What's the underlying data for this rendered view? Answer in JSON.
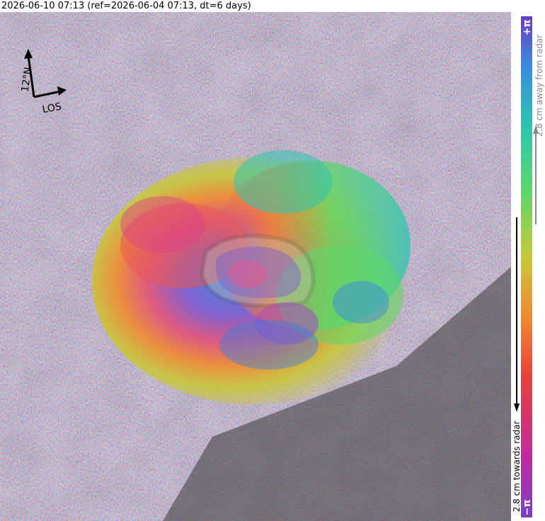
{
  "header": {
    "title": "2026-06-10 07:13 (ref=2026-06-04 07:13, dt=6 days)"
  },
  "compass": {
    "north_label": "12°N",
    "los_label": "LOS"
  },
  "colorbar": {
    "top_label": "+π",
    "bottom_label": "−π",
    "away_label": "2.8 cm away from radar",
    "towards_label": "2.8 cm towards radar",
    "colors": [
      "#c02aa0",
      "#e8403a",
      "#f08a30",
      "#c7c838",
      "#5bd86a",
      "#2dc5b0",
      "#3a8be0",
      "#6a3cc8"
    ]
  }
}
